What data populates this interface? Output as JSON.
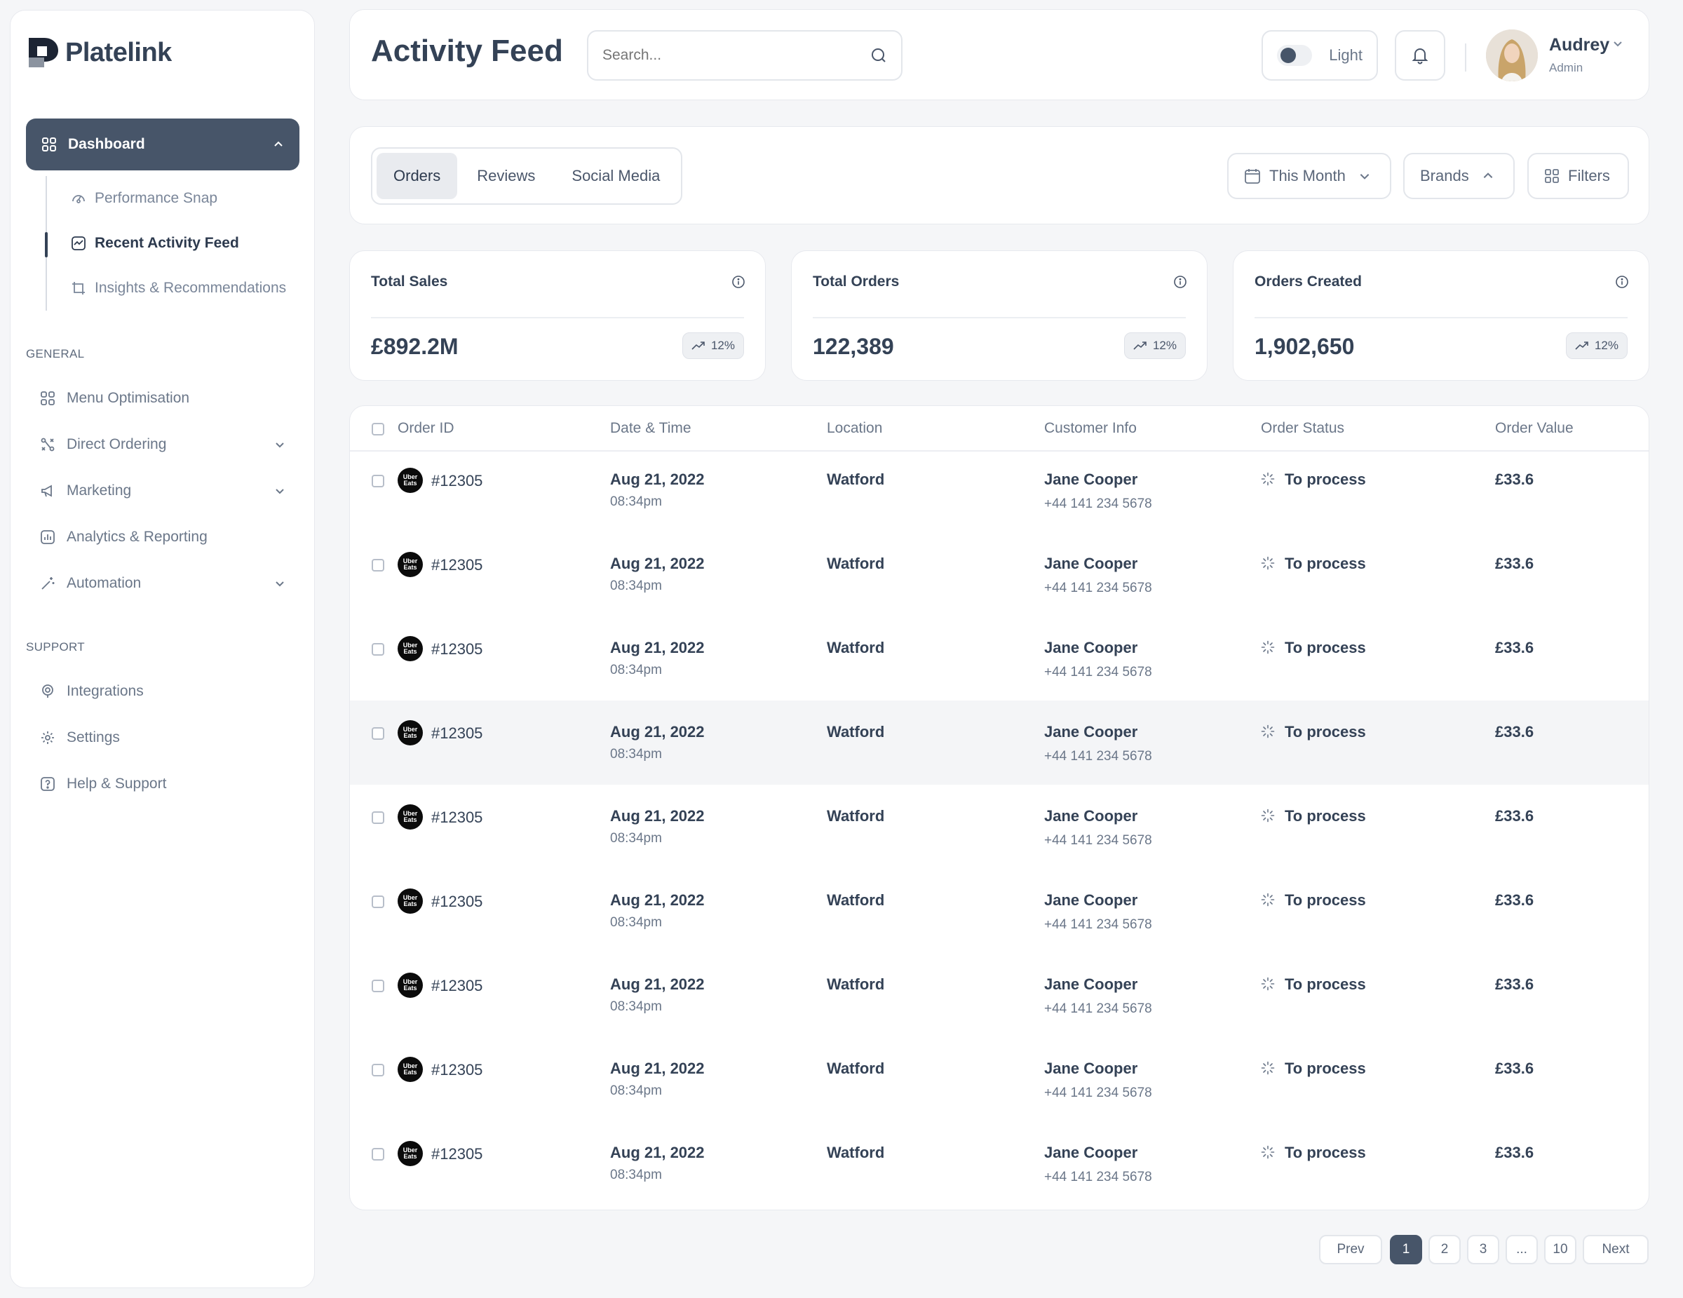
{
  "brand": {
    "name": "Platelink"
  },
  "sidebar": {
    "dashboard_label": "Dashboard",
    "sub_items": [
      {
        "label": "Performance Snap",
        "icon": "gauge-icon"
      },
      {
        "label": "Recent Activity Feed",
        "icon": "activity-icon",
        "active": true
      },
      {
        "label": "Insights & Recommendations",
        "icon": "insights-icon"
      }
    ],
    "general_label": "GENERAL",
    "general_items": [
      {
        "label": "Menu Optimisation",
        "icon": "grid-icon",
        "has_chevron": false
      },
      {
        "label": "Direct Ordering",
        "icon": "route-icon",
        "has_chevron": true
      },
      {
        "label": "Marketing",
        "icon": "megaphone-icon",
        "has_chevron": true
      },
      {
        "label": "Analytics & Reporting",
        "icon": "chart-icon",
        "has_chevron": false
      },
      {
        "label": "Automation",
        "icon": "wand-icon",
        "has_chevron": true
      }
    ],
    "support_label": "SUPPORT",
    "support_items": [
      {
        "label": "Integrations",
        "icon": "integrations-icon"
      },
      {
        "label": "Settings",
        "icon": "gear-icon"
      },
      {
        "label": "Help & Support",
        "icon": "help-icon"
      }
    ]
  },
  "header": {
    "title": "Activity Feed",
    "search_placeholder": "Search...",
    "theme_label": "Light",
    "user": {
      "name": "Audrey",
      "role": "Admin"
    }
  },
  "toolbar": {
    "tabs": [
      "Orders",
      "Reviews",
      "Social Media"
    ],
    "active_tab": "Orders",
    "date_filter": "This Month",
    "brands_label": "Brands",
    "filters_label": "Filters"
  },
  "stats": [
    {
      "label": "Total Sales",
      "value": "£892.2M",
      "change": "12%"
    },
    {
      "label": "Total Orders",
      "value": "122,389",
      "change": "12%"
    },
    {
      "label": "Orders Created",
      "value": "1,902,650",
      "change": "12%"
    }
  ],
  "table": {
    "columns": [
      "Order ID",
      "Date & Time",
      "Location",
      "Customer Info",
      "Order Status",
      "Order Value"
    ],
    "brand_badge": "Uber Eats",
    "rows": [
      {
        "order_id": "#12305",
        "date": "Aug 21, 2022",
        "time": "08:34pm",
        "location": "Watford",
        "customer": "Jane Cooper",
        "phone": "+44 141 234 5678",
        "status": "To process",
        "value": "£33.6"
      },
      {
        "order_id": "#12305",
        "date": "Aug 21, 2022",
        "time": "08:34pm",
        "location": "Watford",
        "customer": "Jane Cooper",
        "phone": "+44 141 234 5678",
        "status": "To process",
        "value": "£33.6"
      },
      {
        "order_id": "#12305",
        "date": "Aug 21, 2022",
        "time": "08:34pm",
        "location": "Watford",
        "customer": "Jane Cooper",
        "phone": "+44 141 234 5678",
        "status": "To process",
        "value": "£33.6"
      },
      {
        "order_id": "#12305",
        "date": "Aug 21, 2022",
        "time": "08:34pm",
        "location": "Watford",
        "customer": "Jane Cooper",
        "phone": "+44 141 234 5678",
        "status": "To process",
        "value": "£33.6",
        "highlighted": true
      },
      {
        "order_id": "#12305",
        "date": "Aug 21, 2022",
        "time": "08:34pm",
        "location": "Watford",
        "customer": "Jane Cooper",
        "phone": "+44 141 234 5678",
        "status": "To process",
        "value": "£33.6"
      },
      {
        "order_id": "#12305",
        "date": "Aug 21, 2022",
        "time": "08:34pm",
        "location": "Watford",
        "customer": "Jane Cooper",
        "phone": "+44 141 234 5678",
        "status": "To process",
        "value": "£33.6"
      },
      {
        "order_id": "#12305",
        "date": "Aug 21, 2022",
        "time": "08:34pm",
        "location": "Watford",
        "customer": "Jane Cooper",
        "phone": "+44 141 234 5678",
        "status": "To process",
        "value": "£33.6"
      },
      {
        "order_id": "#12305",
        "date": "Aug 21, 2022",
        "time": "08:34pm",
        "location": "Watford",
        "customer": "Jane Cooper",
        "phone": "+44 141 234 5678",
        "status": "To process",
        "value": "£33.6"
      },
      {
        "order_id": "#12305",
        "date": "Aug 21, 2022",
        "time": "08:34pm",
        "location": "Watford",
        "customer": "Jane Cooper",
        "phone": "+44 141 234 5678",
        "status": "To process",
        "value": "£33.6"
      }
    ]
  },
  "pagination": {
    "prev": "Prev",
    "pages": [
      "1",
      "2",
      "3",
      "...",
      "10"
    ],
    "current": "1",
    "next": "Next"
  },
  "colors": {
    "accent": "#475569",
    "text": "#344256",
    "muted": "#6b7789",
    "border": "#e3e6eb"
  }
}
